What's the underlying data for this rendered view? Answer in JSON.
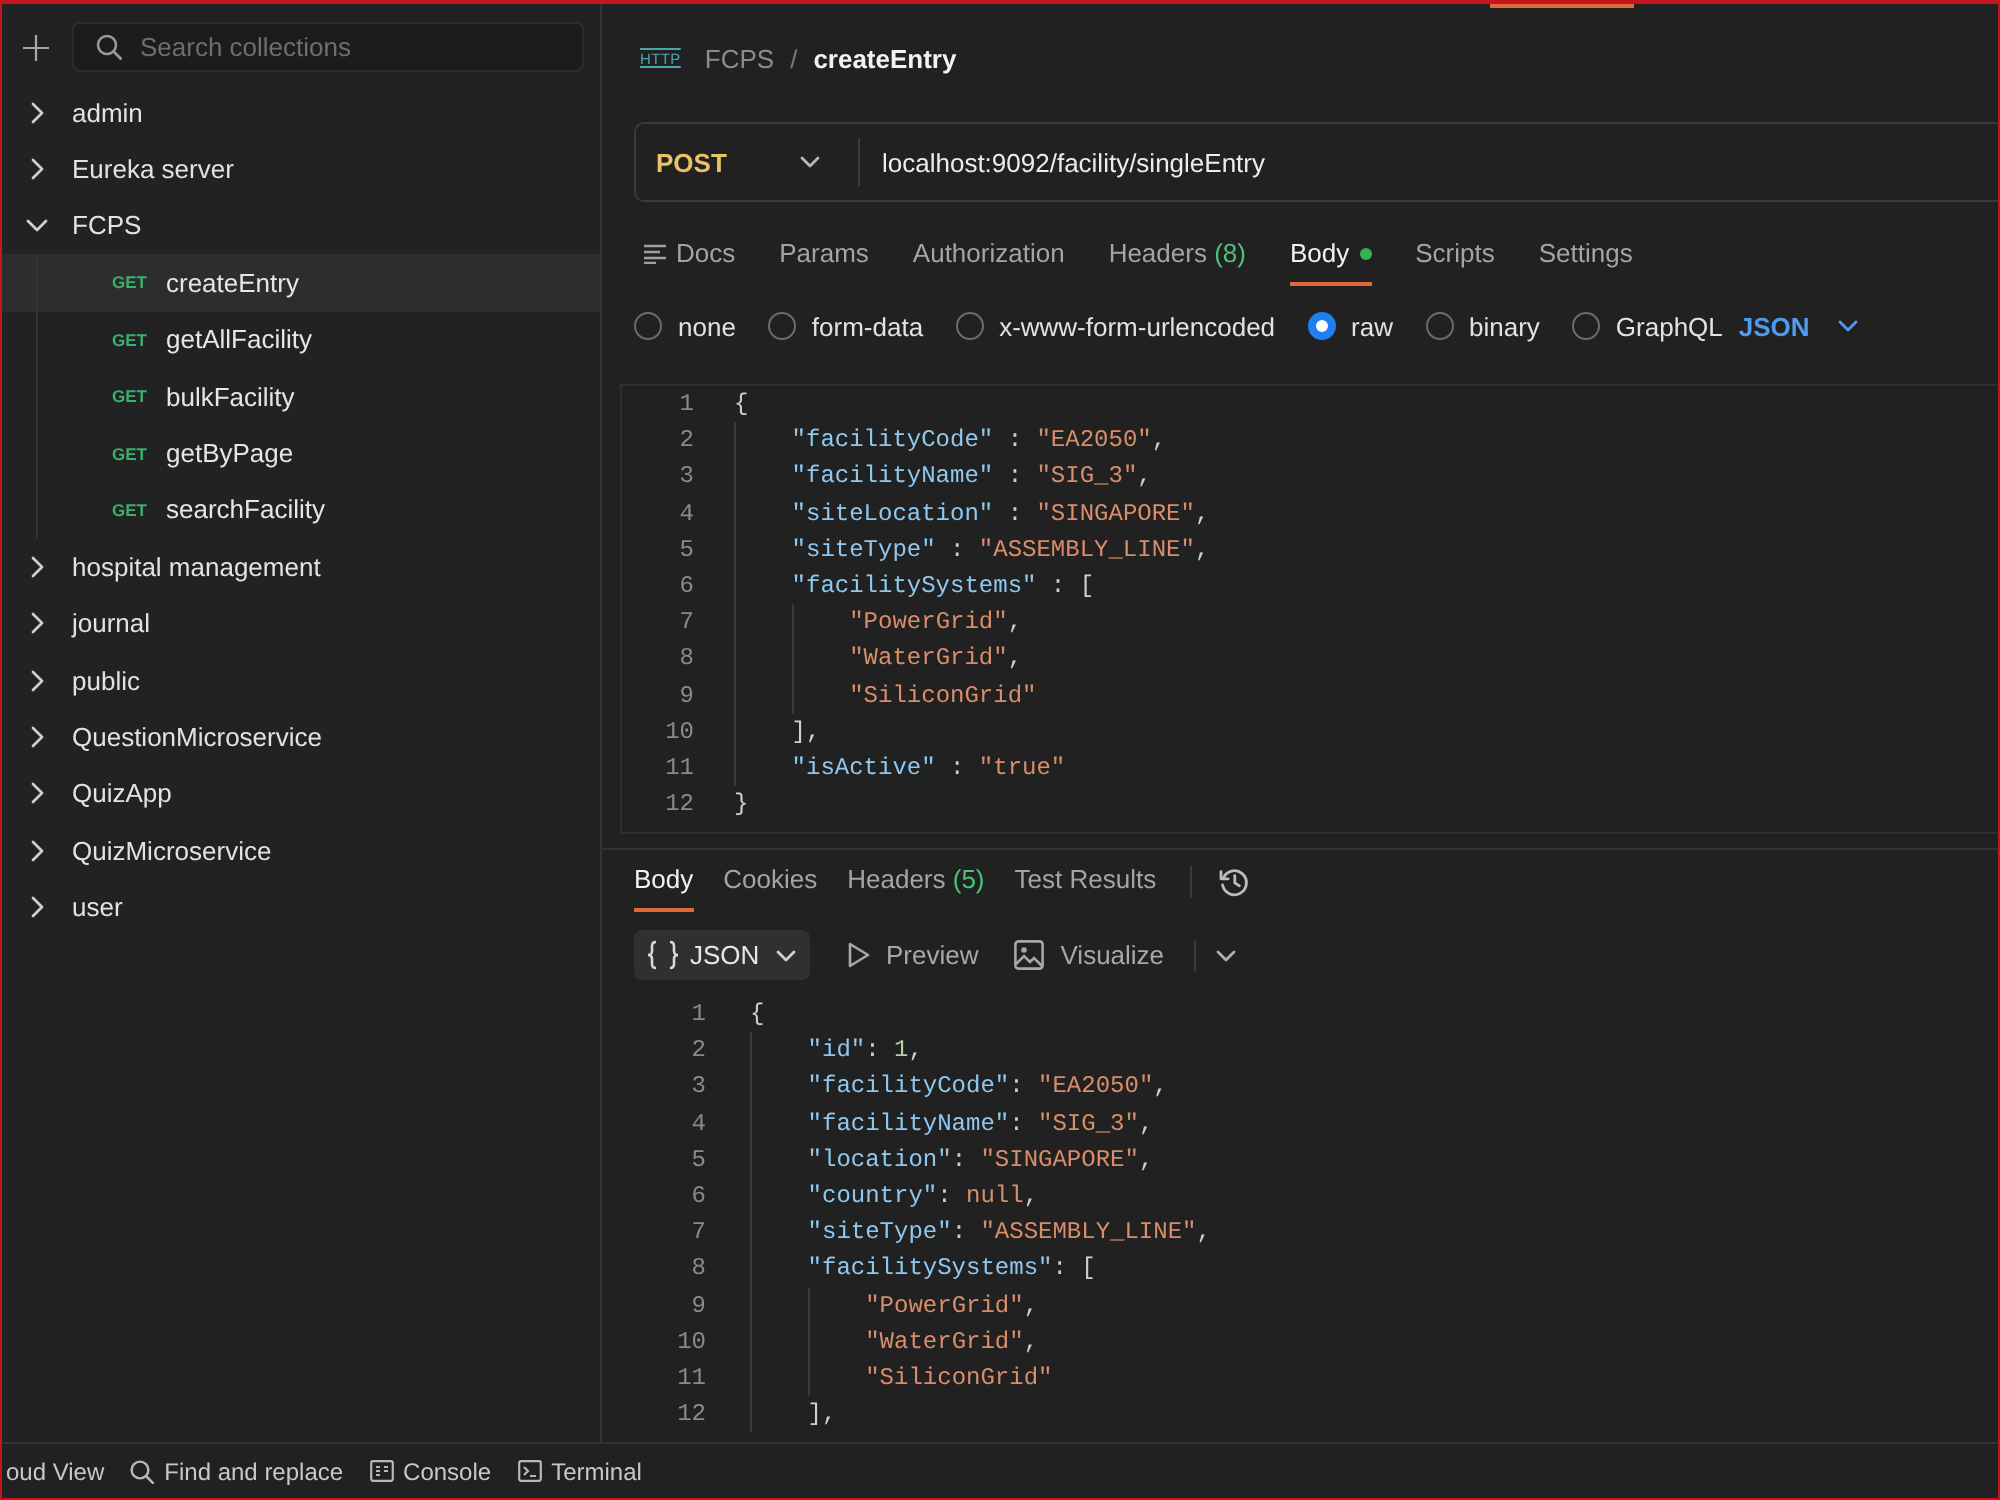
{
  "sidebar": {
    "search": {
      "placeholder": "Search collections"
    },
    "collections": [
      {
        "name": "admin",
        "expanded": false
      },
      {
        "name": "Eureka server",
        "expanded": false
      },
      {
        "name": "FCPS",
        "expanded": true,
        "children": [
          {
            "method": "GET",
            "name": "createEntry",
            "selected": true
          },
          {
            "method": "GET",
            "name": "getAllFacility",
            "selected": false
          },
          {
            "method": "GET",
            "name": "bulkFacility",
            "selected": false
          },
          {
            "method": "GET",
            "name": "getByPage",
            "selected": false
          },
          {
            "method": "GET",
            "name": "searchFacility",
            "selected": false
          }
        ]
      },
      {
        "name": "hospital management",
        "expanded": false
      },
      {
        "name": "journal",
        "expanded": false
      },
      {
        "name": "public",
        "expanded": false
      },
      {
        "name": "QuestionMicroservice",
        "expanded": false
      },
      {
        "name": "QuizApp",
        "expanded": false
      },
      {
        "name": "QuizMicroservice",
        "expanded": false
      },
      {
        "name": "user",
        "expanded": false
      }
    ]
  },
  "breadcrumb": {
    "icon_label": "HTTP",
    "parent": "FCPS",
    "separator": "/",
    "current": "createEntry"
  },
  "request": {
    "method": "POST",
    "url": "localhost:9092/facility/singleEntry",
    "tabs": [
      {
        "label": "Docs",
        "kind": "docs",
        "selected": false,
        "indicator": false
      },
      {
        "label": "Params",
        "kind": "plain",
        "selected": false,
        "indicator": false
      },
      {
        "label": "Authorization",
        "kind": "plain",
        "selected": false,
        "indicator": false
      },
      {
        "label": "Headers",
        "count": "(8)",
        "kind": "plain",
        "selected": false,
        "indicator": false
      },
      {
        "label": "Body",
        "kind": "plain",
        "selected": true,
        "indicator": true
      },
      {
        "label": "Scripts",
        "kind": "plain",
        "selected": false,
        "indicator": false
      },
      {
        "label": "Settings",
        "kind": "plain",
        "selected": false,
        "indicator": false
      }
    ],
    "body_types": [
      {
        "label": "none",
        "selected": false
      },
      {
        "label": "form-data",
        "selected": false
      },
      {
        "label": "x-www-form-urlencoded",
        "selected": false
      },
      {
        "label": "raw",
        "selected": true
      },
      {
        "label": "binary",
        "selected": false
      },
      {
        "label": "GraphQL",
        "selected": false
      }
    ],
    "body_format": "JSON",
    "body_lines": [
      {
        "number": "1",
        "text": "{"
      },
      {
        "number": "2",
        "text": "    \"facilityCode\" : \"EA2050\","
      },
      {
        "number": "3",
        "text": "    \"facilityName\" : \"SIG_3\","
      },
      {
        "number": "4",
        "text": "    \"siteLocation\" : \"SINGAPORE\","
      },
      {
        "number": "5",
        "text": "    \"siteType\" : \"ASSEMBLY_LINE\","
      },
      {
        "number": "6",
        "text": "    \"facilitySystems\" : ["
      },
      {
        "number": "7",
        "text": "        \"PowerGrid\","
      },
      {
        "number": "8",
        "text": "        \"WaterGrid\","
      },
      {
        "number": "9",
        "text": "        \"SiliconGrid\""
      },
      {
        "number": "10",
        "text": "    ],"
      },
      {
        "number": "11",
        "text": "    \"isActive\" : \"true\""
      },
      {
        "number": "12",
        "text": "}"
      }
    ]
  },
  "response": {
    "tabs": [
      {
        "label": "Body",
        "selected": true
      },
      {
        "label": "Cookies",
        "selected": false
      },
      {
        "label": "Headers",
        "count": "(5)",
        "selected": false
      },
      {
        "label": "Test Results",
        "selected": false
      }
    ],
    "format": "JSON",
    "view_options": [
      {
        "label": "Preview",
        "kind": "play"
      },
      {
        "label": "Visualize",
        "kind": "image"
      }
    ],
    "body_lines": [
      {
        "number": "1",
        "text": "{"
      },
      {
        "number": "2",
        "text": "    \"id\": 1,"
      },
      {
        "number": "3",
        "text": "    \"facilityCode\": \"EA2050\","
      },
      {
        "number": "4",
        "text": "    \"facilityName\": \"SIG_3\","
      },
      {
        "number": "5",
        "text": "    \"location\": \"SINGAPORE\","
      },
      {
        "number": "6",
        "text": "    \"country\": null,"
      },
      {
        "number": "7",
        "text": "    \"siteType\": \"ASSEMBLY_LINE\","
      },
      {
        "number": "8",
        "text": "    \"facilitySystems\": ["
      },
      {
        "number": "9",
        "text": "        \"PowerGrid\","
      },
      {
        "number": "10",
        "text": "        \"WaterGrid\","
      },
      {
        "number": "11",
        "text": "        \"SiliconGrid\""
      },
      {
        "number": "12",
        "text": "    ],"
      }
    ]
  },
  "status_bar": {
    "items": [
      {
        "label": "oud View",
        "kind": "plain"
      },
      {
        "label": "Find and replace",
        "kind": "search"
      },
      {
        "label": "Console",
        "kind": "console"
      },
      {
        "label": "Terminal",
        "kind": "terminal"
      }
    ]
  }
}
